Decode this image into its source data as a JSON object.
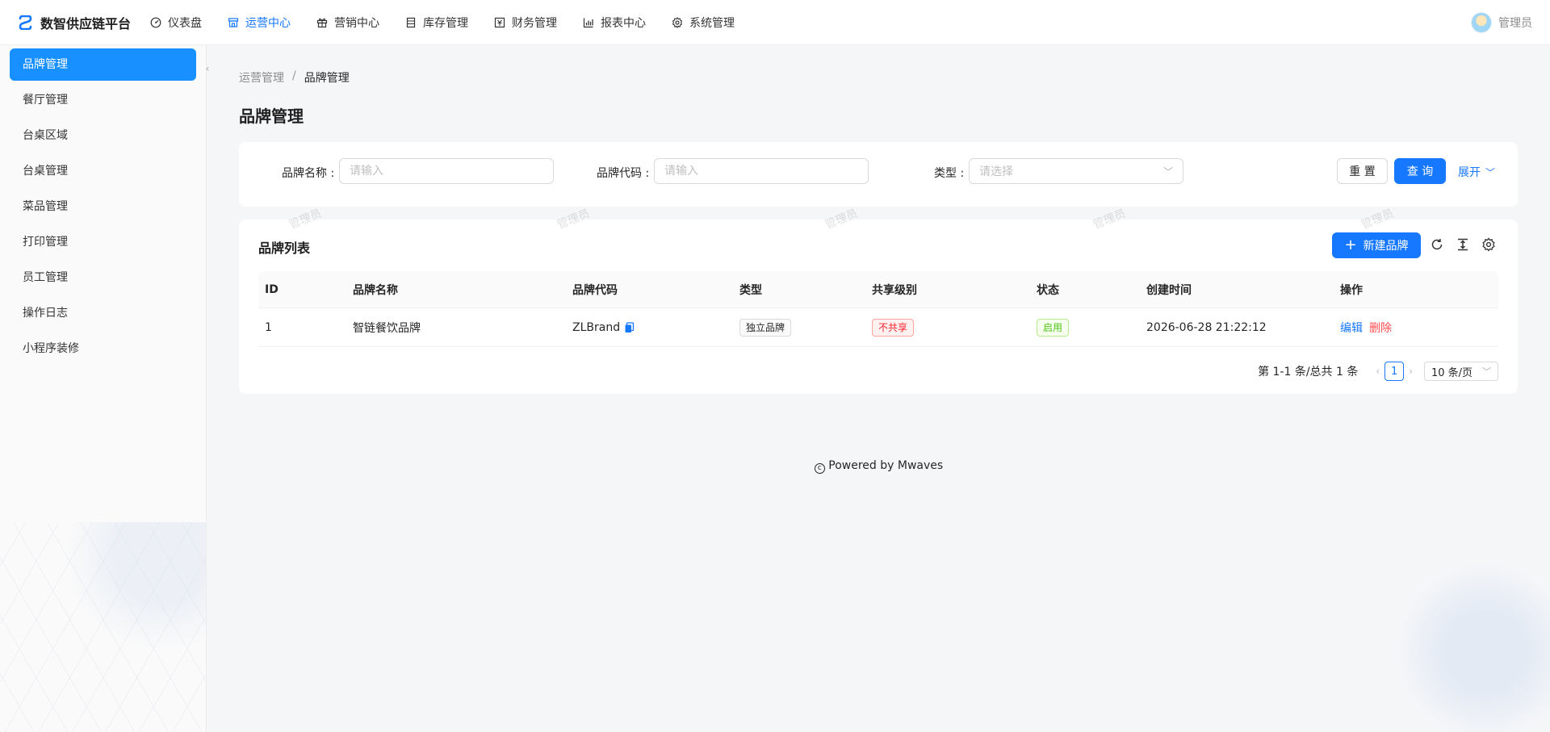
{
  "header": {
    "brand_title": "数智供应链平台",
    "nav": [
      {
        "label": "仪表盘",
        "icon": "dashboard-icon"
      },
      {
        "label": "运营中心",
        "icon": "shop-icon",
        "active": true
      },
      {
        "label": "营销中心",
        "icon": "gift-icon"
      },
      {
        "label": "库存管理",
        "icon": "inventory-icon"
      },
      {
        "label": "财务管理",
        "icon": "finance-icon"
      },
      {
        "label": "报表中心",
        "icon": "bar-chart-icon"
      },
      {
        "label": "系统管理",
        "icon": "gear-icon"
      }
    ],
    "user_name": "管理员"
  },
  "sidebar": {
    "items": [
      {
        "label": "品牌管理",
        "active": true
      },
      {
        "label": "餐厅管理"
      },
      {
        "label": "台桌区域"
      },
      {
        "label": "台桌管理"
      },
      {
        "label": "菜品管理"
      },
      {
        "label": "打印管理"
      },
      {
        "label": "员工管理"
      },
      {
        "label": "操作日志"
      },
      {
        "label": "小程序装修"
      }
    ]
  },
  "breadcrumb": {
    "parent": "运营管理",
    "separator": "/",
    "current": "品牌管理"
  },
  "page_title": "品牌管理",
  "search": {
    "brand_name_label": "品牌名称 :",
    "brand_name_placeholder": "请输入",
    "brand_code_label": "品牌代码 :",
    "brand_code_placeholder": "请输入",
    "type_label": "类型 :",
    "type_placeholder": "请选择",
    "reset_label": "重 置",
    "query_label": "查 询",
    "expand_label": "展开"
  },
  "list": {
    "title": "品牌列表",
    "new_button_label": "新建品牌",
    "columns": [
      "ID",
      "品牌名称",
      "品牌代码",
      "类型",
      "共享级别",
      "状态",
      "创建时间",
      "操作"
    ],
    "rows": [
      {
        "id": "1",
        "name": "智链餐饮品牌",
        "code": "ZLBrand",
        "type": "独立品牌",
        "share_level": "不共享",
        "status": "启用",
        "created_at": "2026-06-28 21:22:12",
        "edit_label": "编辑",
        "delete_label": "删除"
      }
    ],
    "pagination": {
      "total_text": "第 1-1 条/总共 1 条",
      "current_page": "1",
      "page_size": "10 条/页"
    }
  },
  "watermark_text": "管理员",
  "footer_text": "Powered by Mwaves",
  "colors": {
    "primary": "#1677ff",
    "danger": "#ff4d4f",
    "success": "#52c41a"
  }
}
